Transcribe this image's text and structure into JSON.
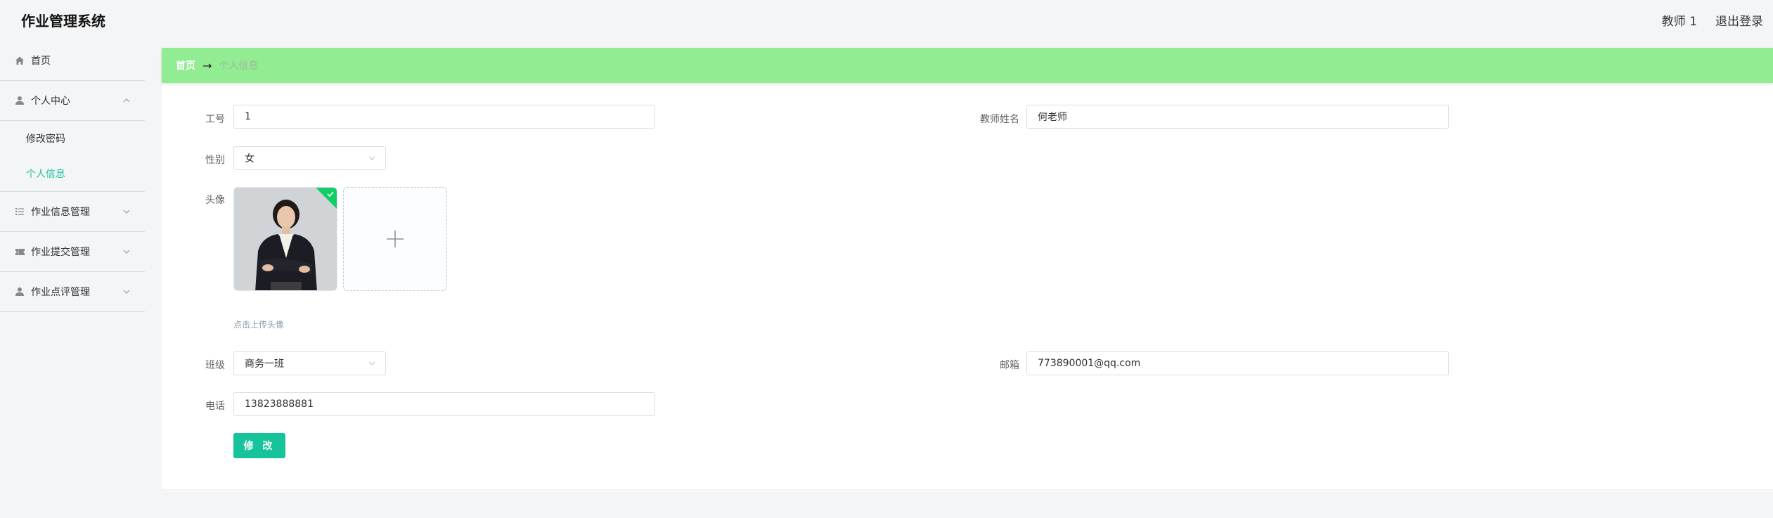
{
  "header": {
    "title": "作业管理系统",
    "user": "教师 1",
    "logout": "退出登录"
  },
  "sidebar": {
    "home": "首页",
    "personal": "个人中心",
    "personal_items": [
      "修改密码",
      "个人信息"
    ],
    "menus": [
      "作业信息管理",
      "作业提交管理",
      "作业点评管理"
    ]
  },
  "breadcrumb": {
    "home": "首页",
    "arrow": "→",
    "current": "个人信息"
  },
  "form": {
    "job_no_label": "工号",
    "job_no_value": "1",
    "teacher_name_label": "教师姓名",
    "teacher_name_value": "何老师",
    "gender_label": "性别",
    "gender_value": "女",
    "avatar_label": "头像",
    "avatar_hint": "点击上传头像",
    "class_label": "班级",
    "class_value": "商务一班",
    "email_label": "邮箱",
    "email_value": "773890001@qq.com",
    "phone_label": "电话",
    "phone_value": "13823888881",
    "submit_label": "修 改"
  },
  "colors": {
    "accent": "#17c39b",
    "breadcrumb_bg": "#92ec92",
    "active_menu": "#20c3a0"
  }
}
